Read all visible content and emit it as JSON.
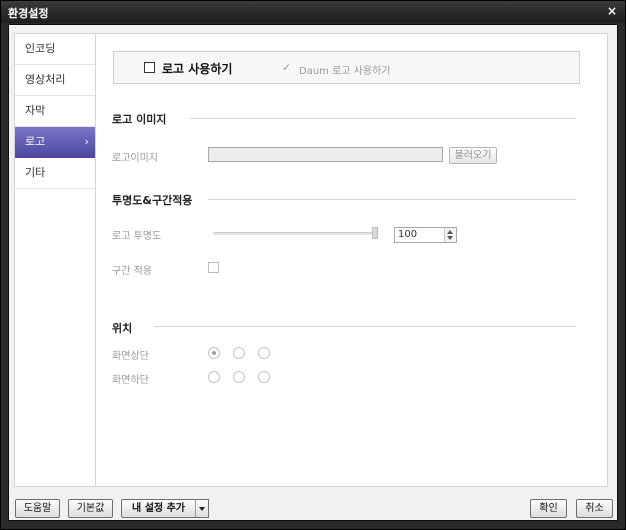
{
  "window": {
    "title": "환경설정",
    "close_glyph": "×"
  },
  "sidebar": {
    "items": [
      {
        "label": "인코딩"
      },
      {
        "label": "영상처리"
      },
      {
        "label": "자막"
      },
      {
        "label": "로고",
        "chevron": "›"
      },
      {
        "label": "기타"
      }
    ]
  },
  "logo": {
    "use_logo_label": "로고 사용하기",
    "use_daum_logo_label": "Daum 로고 사용하기",
    "check_glyph": "✓"
  },
  "logo_image": {
    "section_title": "로고 이미지",
    "field_label": "로고이미지",
    "field_value": "",
    "load_button": "불러오기"
  },
  "transparency": {
    "section_title": "투명도&구간적용",
    "opacity_label": "로고 투명도",
    "opacity_value": "100",
    "opacity_level_percent": 100,
    "range_apply_label": "구간 적용"
  },
  "position": {
    "section_title": "위치",
    "top_label": "화면상단",
    "bottom_label": "화면하단",
    "selected": "top-left"
  },
  "footer": {
    "help": "도움말",
    "defaults": "기본값",
    "add_my_setting": "내 설정 추가",
    "ok": "확인",
    "cancel": "취소"
  }
}
